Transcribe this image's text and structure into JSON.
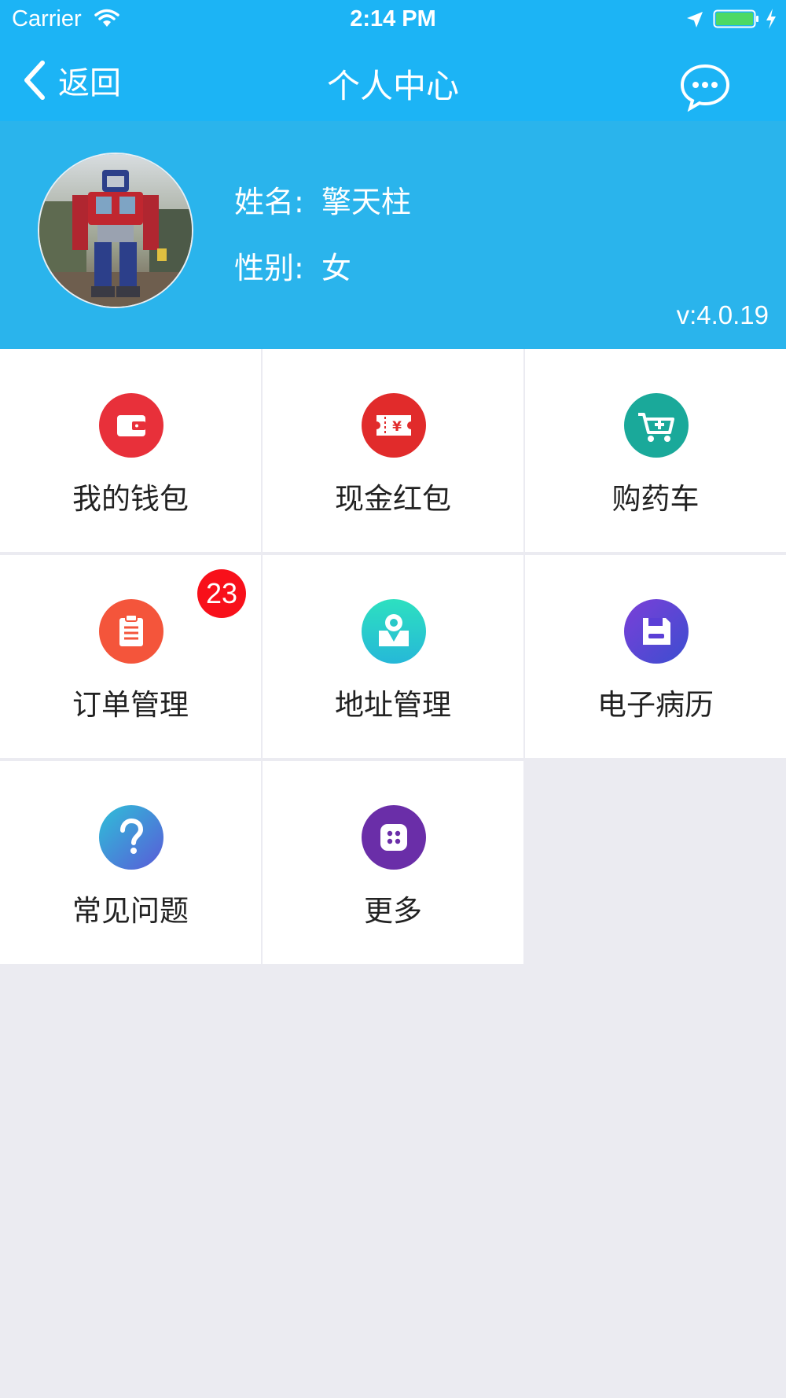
{
  "status_bar": {
    "carrier": "Carrier",
    "time": "2:14 PM"
  },
  "nav": {
    "back_label": "返回",
    "title": "个人中心",
    "message_icon": "chat-bubble-icon"
  },
  "profile": {
    "name_label": "姓名:",
    "name_value": "擎天柱",
    "gender_label": "性别:",
    "gender_value": "女",
    "version": "v:4.0.19"
  },
  "menu": {
    "wallet": {
      "label": "我的钱包",
      "icon": "wallet-icon",
      "color": "#e8303a"
    },
    "coupon": {
      "label": "现金红包",
      "icon": "red-packet-icon",
      "color": "#e12b2b"
    },
    "cart": {
      "label": "购药车",
      "icon": "medicine-cart-icon",
      "color": "#1aa99a"
    },
    "orders": {
      "label": "订单管理",
      "icon": "clipboard-icon",
      "color": "#f4553b",
      "badge": "23"
    },
    "address": {
      "label": "地址管理",
      "icon": "map-pin-icon",
      "color": "#29d1c6"
    },
    "records": {
      "label": "电子病历",
      "icon": "medical-record-icon",
      "color": "#5b3fd6"
    },
    "faq": {
      "label": "常见问题",
      "icon": "question-icon",
      "color": "#3f8ee0"
    },
    "more": {
      "label": "更多",
      "icon": "more-apps-icon",
      "color": "#6a2ea8"
    }
  },
  "colors": {
    "primary": "#1cb4f5",
    "profile_bg": "#2ab4ec",
    "page_bg": "#ebebf1",
    "badge": "#f8101a"
  }
}
